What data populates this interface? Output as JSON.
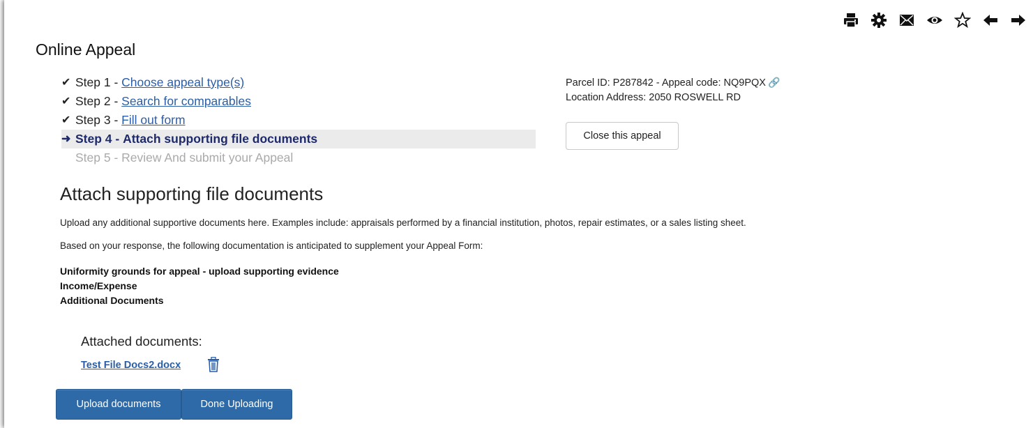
{
  "toolbar": {
    "icons": [
      "print-icon",
      "gear-icon",
      "mail-icon",
      "eye-icon",
      "star-icon",
      "arrow-left-icon",
      "arrow-right-icon"
    ]
  },
  "page_title": "Online Appeal",
  "steps": [
    {
      "prefix": "Step 1 - ",
      "label": "Choose appeal type(s)",
      "status": "done"
    },
    {
      "prefix": "Step 2 - ",
      "label": "Search for comparables",
      "status": "done"
    },
    {
      "prefix": "Step 3 - ",
      "label": "Fill out form",
      "status": "done"
    },
    {
      "prefix": "Step 4 - ",
      "label": "Attach supporting file documents",
      "status": "current"
    },
    {
      "prefix": "Step 5 - ",
      "label": "Review And submit your Appeal",
      "status": "pending"
    }
  ],
  "parcel": {
    "line1": "Parcel ID: P287842 - Appeal code: NQ9PQX",
    "line2": "Location Address: 2050 ROSWELL RD"
  },
  "close_button": "Close this appeal",
  "section_title": "Attach supporting file documents",
  "para1": "Upload any additional supportive documents here. Examples include: appraisals performed by a financial institution, photos, repair estimates, or a sales listing sheet.",
  "para2": "Based on your response, the following documentation is anticipated to supplement your Appeal Form:",
  "documents": [
    "Uniformity grounds for appeal - upload supporting evidence",
    "Income/Expense",
    "Additional Documents"
  ],
  "attached_label": "Attached documents:",
  "attached_file": "Test File Docs2.docx",
  "upload_button": "Upload documents",
  "done_button": "Done Uploading",
  "colors": {
    "link": "#2a5ea8",
    "primary": "#2f6aa8",
    "current_step": "#1e2a6b"
  }
}
